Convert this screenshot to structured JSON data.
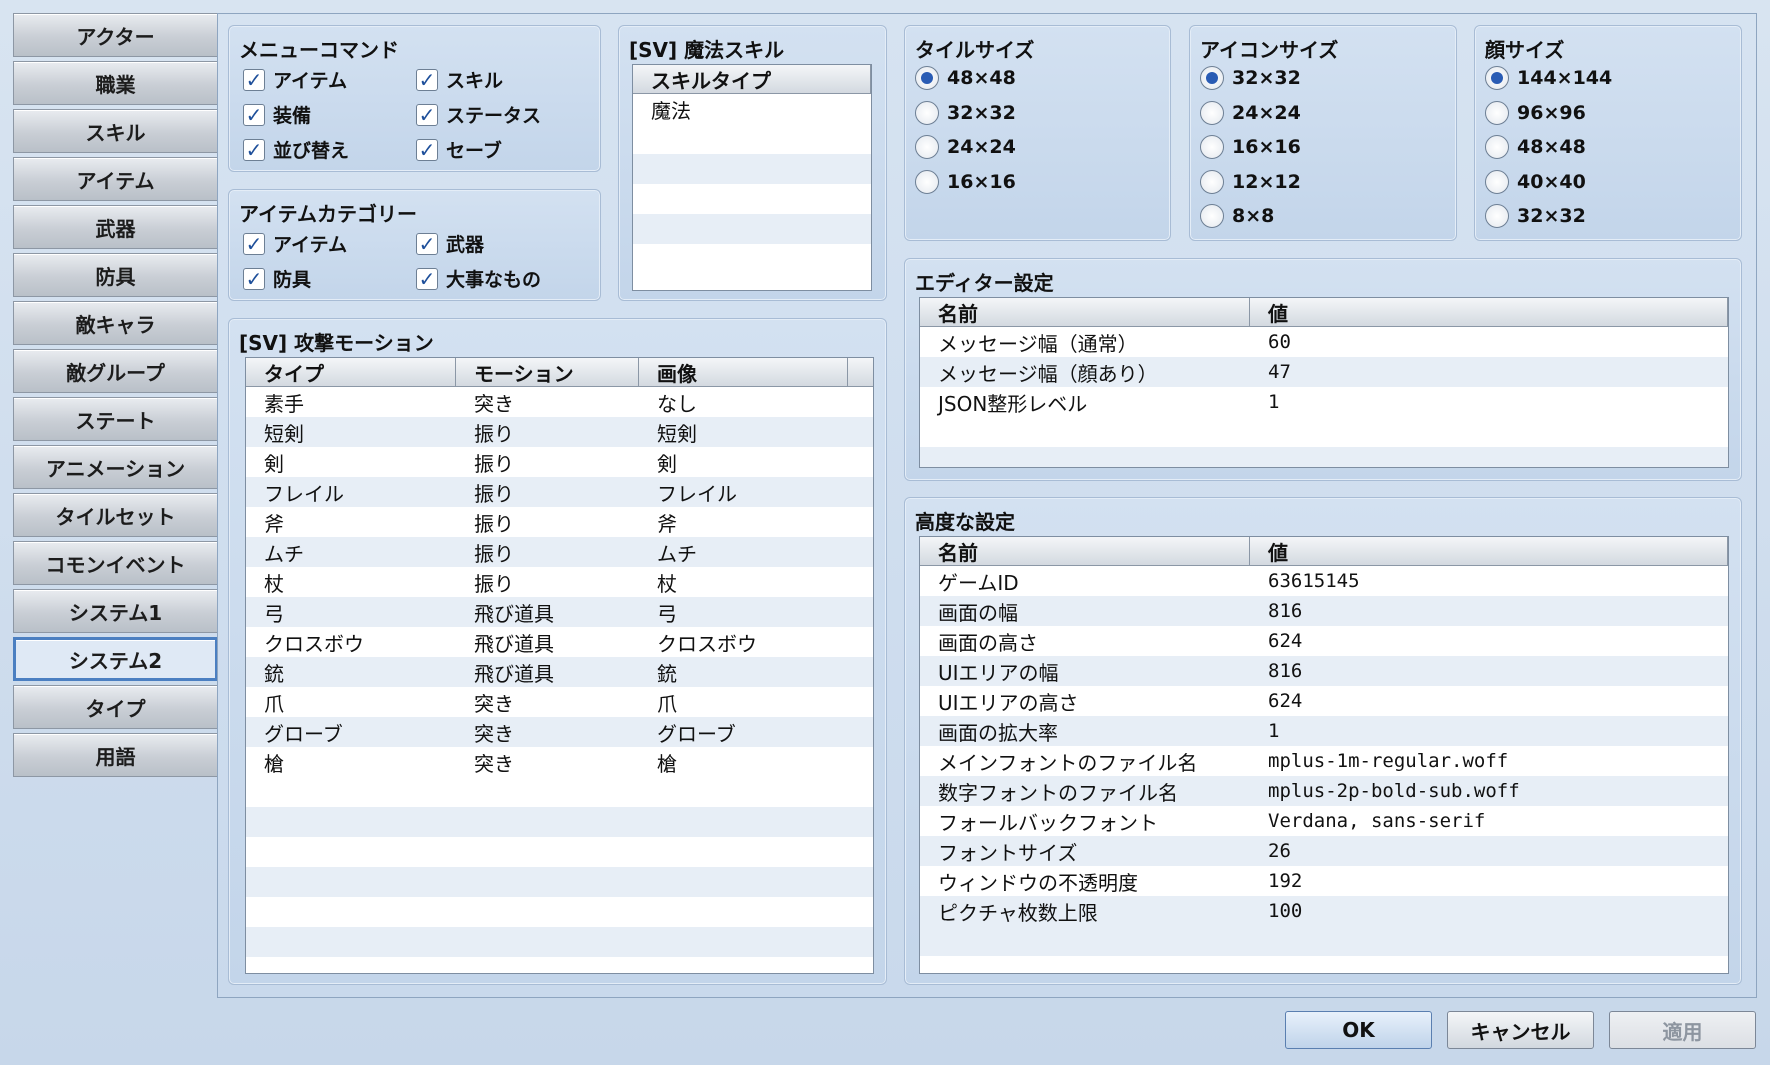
{
  "sidebar": {
    "tabs": [
      "アクター",
      "職業",
      "スキル",
      "アイテム",
      "武器",
      "防具",
      "敵キャラ",
      "敵グループ",
      "ステート",
      "アニメーション",
      "タイルセット",
      "コモンイベント",
      "システム1",
      "システム2",
      "タイプ",
      "用語"
    ],
    "active": "システム2"
  },
  "menu_commands": {
    "title": "メニューコマンド",
    "items": [
      {
        "label": "アイテム",
        "checked": true
      },
      {
        "label": "スキル",
        "checked": true
      },
      {
        "label": "装備",
        "checked": true
      },
      {
        "label": "ステータス",
        "checked": true
      },
      {
        "label": "並び替え",
        "checked": true
      },
      {
        "label": "セーブ",
        "checked": true
      }
    ]
  },
  "item_categories": {
    "title": "アイテムカテゴリー",
    "items": [
      {
        "label": "アイテム",
        "checked": true
      },
      {
        "label": "武器",
        "checked": true
      },
      {
        "label": "防具",
        "checked": true
      },
      {
        "label": "大事なもの",
        "checked": true
      }
    ]
  },
  "magic_skill": {
    "title": "[SV] 魔法スキル",
    "header": "スキルタイプ",
    "rows": [
      "魔法"
    ]
  },
  "attack_motion": {
    "title": "[SV] 攻撃モーション",
    "headers": [
      "タイプ",
      "モーション",
      "画像"
    ],
    "rows": [
      [
        "素手",
        "突き",
        "なし"
      ],
      [
        "短剣",
        "振り",
        "短剣"
      ],
      [
        "剣",
        "振り",
        "剣"
      ],
      [
        "フレイル",
        "振り",
        "フレイル"
      ],
      [
        "斧",
        "振り",
        "斧"
      ],
      [
        "ムチ",
        "振り",
        "ムチ"
      ],
      [
        "杖",
        "振り",
        "杖"
      ],
      [
        "弓",
        "飛び道具",
        "弓"
      ],
      [
        "クロスボウ",
        "飛び道具",
        "クロスボウ"
      ],
      [
        "銃",
        "飛び道具",
        "銃"
      ],
      [
        "爪",
        "突き",
        "爪"
      ],
      [
        "グローブ",
        "突き",
        "グローブ"
      ],
      [
        "槍",
        "突き",
        "槍"
      ]
    ]
  },
  "tile_size": {
    "title": "タイルサイズ",
    "options": [
      "48×48",
      "32×32",
      "24×24",
      "16×16"
    ],
    "selected": 0
  },
  "icon_size": {
    "title": "アイコンサイズ",
    "options": [
      "32×32",
      "24×24",
      "16×16",
      "12×12",
      "8×8"
    ],
    "selected": 0
  },
  "face_size": {
    "title": "顔サイズ",
    "options": [
      "144×144",
      "96×96",
      "48×48",
      "40×40",
      "32×32"
    ],
    "selected": 0
  },
  "editor_settings": {
    "title": "エディター設定",
    "headers": [
      "名前",
      "値"
    ],
    "rows": [
      [
        "メッセージ幅（通常）",
        "60"
      ],
      [
        "メッセージ幅（顔あり）",
        "47"
      ],
      [
        "JSON整形レベル",
        "1"
      ]
    ]
  },
  "advanced_settings": {
    "title": "高度な設定",
    "headers": [
      "名前",
      "値"
    ],
    "rows": [
      [
        "ゲームID",
        "63615145"
      ],
      [
        "画面の幅",
        "816"
      ],
      [
        "画面の高さ",
        "624"
      ],
      [
        "UIエリアの幅",
        "816"
      ],
      [
        "UIエリアの高さ",
        "624"
      ],
      [
        "画面の拡大率",
        "1"
      ],
      [
        "メインフォントのファイル名",
        "mplus-1m-regular.woff"
      ],
      [
        "数字フォントのファイル名",
        "mplus-2p-bold-sub.woff"
      ],
      [
        "フォールバックフォント",
        "Verdana, sans-serif"
      ],
      [
        "フォントサイズ",
        "26"
      ],
      [
        "ウィンドウの不透明度",
        "192"
      ],
      [
        "ピクチャ枚数上限",
        "100"
      ]
    ]
  },
  "buttons": {
    "ok": "OK",
    "cancel": "キャンセル",
    "apply": "適用"
  }
}
